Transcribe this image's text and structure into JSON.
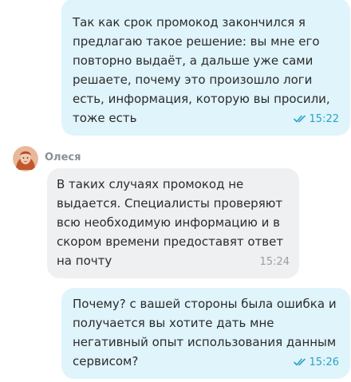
{
  "messages": [
    {
      "direction": "outgoing",
      "text": "Так как срок промокод закончился я предлагаю такое решение: вы мне его повторно выдаёт, а дальше уже сами решаете, почему это произошло логи есть, информация, которую вы просили, тоже есть",
      "time": "15:22",
      "status_icon": "double-check-icon"
    },
    {
      "direction": "incoming",
      "sender": "Олеся",
      "avatar": "avatar-photo",
      "text": "В таких случаях промокод не выдается. Специалисты проверяют всю необходимую информацию и в скором времени предоставят ответ на почту",
      "time": "15:24"
    },
    {
      "direction": "outgoing",
      "text": "Почему? с вашей стороны была ошибка и получается вы хотите дать мне негативный опыт использования данным сервисом?",
      "time": "15:26",
      "status_icon": "double-check-icon"
    }
  ],
  "colors": {
    "outgoing_bubble": "#dff4fb",
    "incoming_bubble": "#eff0f2",
    "accent": "#2aa3c9",
    "sender_name": "#8a8f96"
  }
}
